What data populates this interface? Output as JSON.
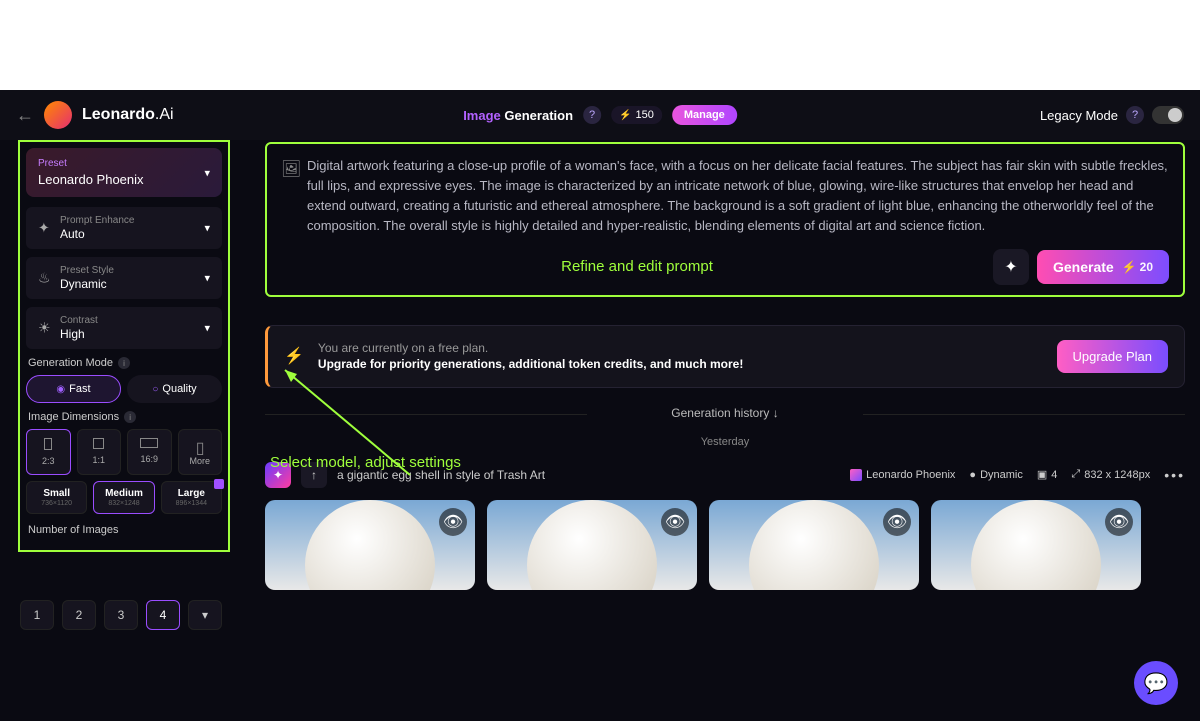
{
  "header": {
    "brand_main": "Leonardo",
    "brand_suffix": ".Ai",
    "title_prefix": "Image",
    "title_main": "Generation",
    "tokens": "150",
    "manage": "Manage",
    "legacy": "Legacy Mode"
  },
  "sidebar": {
    "preset": {
      "label": "Preset",
      "value": "Leonardo Phoenix"
    },
    "enhance": {
      "label": "Prompt Enhance",
      "value": "Auto"
    },
    "style": {
      "label": "Preset Style",
      "value": "Dynamic"
    },
    "contrast": {
      "label": "Contrast",
      "value": "High"
    },
    "mode_label": "Generation Mode",
    "mode_fast": "Fast",
    "mode_quality": "Quality",
    "dim_label": "Image Dimensions",
    "ratios": [
      "2:3",
      "1:1",
      "16:9",
      "More"
    ],
    "sizes": [
      {
        "name": "Small",
        "dim": "736×1120"
      },
      {
        "name": "Medium",
        "dim": "832×1248"
      },
      {
        "name": "Large",
        "dim": "896×1344"
      }
    ],
    "noi_label": "Number of Images",
    "numbers": [
      "1",
      "2",
      "3",
      "4"
    ]
  },
  "prompt": {
    "text": "Digital artwork featuring a close-up profile of a woman's face, with a focus on her delicate facial features. The subject has fair skin with subtle freckles, full lips, and expressive eyes. The image is characterized by an intricate network of blue, glowing, wire-like structures that envelop her head and extend outward, creating a futuristic and ethereal atmosphere. The background is a soft gradient of light blue, enhancing the otherworldly feel of the composition. The overall style is highly detailed and hyper-realistic, blending elements of digital art and science fiction.",
    "refine": "Refine and edit prompt",
    "generate": "Generate",
    "cost": "20"
  },
  "annotation": {
    "settings": "Select model, adjust settings"
  },
  "upgrade": {
    "line1": "You are currently on a free plan.",
    "line2": "Upgrade for priority generations, additional token credits, and much more!",
    "btn": "Upgrade Plan"
  },
  "history": {
    "label": "Generation history",
    "when": "Yesterday"
  },
  "gen": {
    "prompt": "a gigantic egg shell in style of Trash Art",
    "model": "Leonardo Phoenix",
    "style": "Dynamic",
    "count": "4",
    "res": "832 x 1248px"
  }
}
